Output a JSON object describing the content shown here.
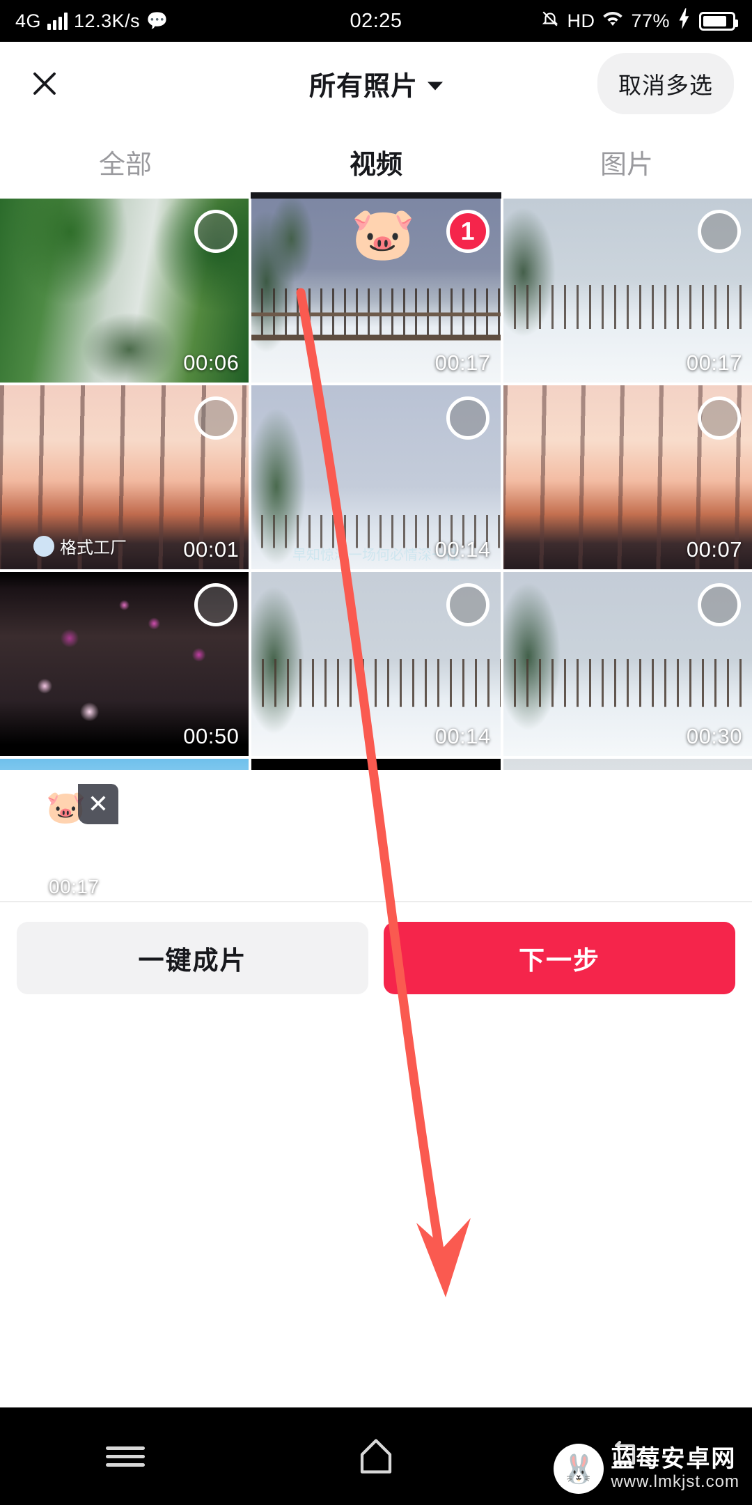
{
  "status_bar": {
    "network": "4G",
    "speed": "12.3K/s",
    "app_icon": "wechat-icon",
    "time": "02:25",
    "mute_icon": "bell-muted-icon",
    "hd": "HD",
    "wifi_icon": "wifi-icon",
    "battery_percent": "77%",
    "charging_icon": "bolt-icon"
  },
  "header": {
    "close_icon": "close-icon",
    "title": "所有照片",
    "dropdown_icon": "chevron-down-icon",
    "multi_select_label": "取消多选"
  },
  "tabs": [
    {
      "label": "全部",
      "active": false
    },
    {
      "label": "视频",
      "active": true
    },
    {
      "label": "图片",
      "active": false
    }
  ],
  "grid": {
    "items": [
      {
        "duration": "00:06",
        "scene": "waterfall",
        "selected": false,
        "badge": ""
      },
      {
        "duration": "00:17",
        "scene": "snow-bridge-pig",
        "selected": true,
        "badge": "1"
      },
      {
        "duration": "00:17",
        "scene": "snow-bridge",
        "selected": false,
        "badge": ""
      },
      {
        "duration": "00:01",
        "scene": "sunset-trees",
        "selected": false,
        "badge": "",
        "watermark": "格式工厂"
      },
      {
        "duration": "00:14",
        "scene": "snow-sky",
        "selected": false,
        "badge": "",
        "caption": "早知惊鸿一场何必情深一往"
      },
      {
        "duration": "00:07",
        "scene": "sunset-trees",
        "selected": false,
        "badge": ""
      },
      {
        "duration": "00:50",
        "scene": "blossom-night",
        "selected": false,
        "badge": ""
      },
      {
        "duration": "00:14",
        "scene": "snow-bridge",
        "selected": false,
        "badge": ""
      },
      {
        "duration": "00:30",
        "scene": "snow-bridge",
        "selected": false,
        "badge": ""
      },
      {
        "duration": "",
        "scene": "birds-snow",
        "selected": false,
        "badge": ""
      },
      {
        "duration": "",
        "scene": "snow-field-dark",
        "selected": false,
        "badge": ""
      },
      {
        "duration": "",
        "scene": "cloudy-sky",
        "selected": false,
        "badge": ""
      }
    ]
  },
  "tray": {
    "items": [
      {
        "duration": "00:17",
        "scene": "snow-bridge-pig",
        "remove_icon": "close-icon"
      }
    ]
  },
  "actions": {
    "secondary_label": "一键成片",
    "primary_label": "下一步"
  },
  "nav_bar": {
    "recents_icon": "menu-icon",
    "home_icon": "home-icon",
    "back_icon": "back-icon"
  },
  "site_watermark": {
    "name": "蓝莓安卓网",
    "url": "www.lmkjst.com",
    "logo_icon": "rabbit-icon"
  },
  "colors": {
    "accent": "#f5254b",
    "text_primary": "#17181c",
    "text_muted": "#9a9a9e",
    "chip_bg": "#f1f1f2",
    "annotation": "#fa5a50"
  },
  "annotation": {
    "type": "arrow",
    "from_label": "selected-video-thumbnail",
    "to_label": "下一步"
  }
}
